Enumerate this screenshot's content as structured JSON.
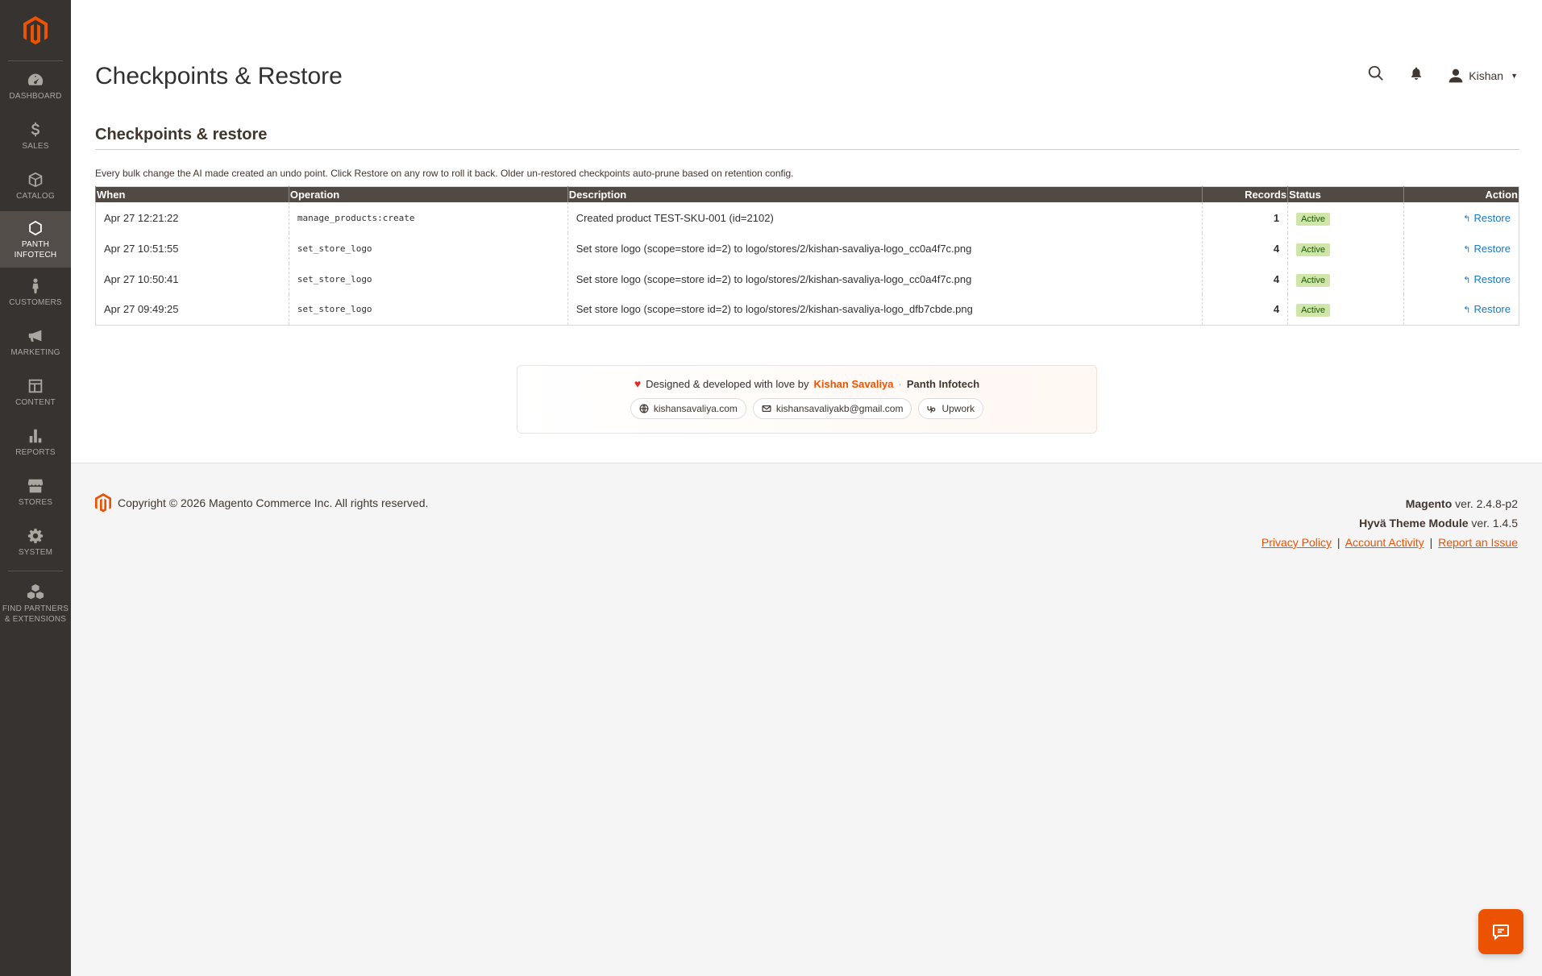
{
  "sidebar": {
    "items": [
      {
        "label": "DASHBOARD",
        "icon": "dashboard-icon"
      },
      {
        "label": "SALES",
        "icon": "dollar-icon"
      },
      {
        "label": "CATALOG",
        "icon": "box-icon"
      },
      {
        "label": "PANTH INFOTECH",
        "icon": "hexagon-icon"
      },
      {
        "label": "CUSTOMERS",
        "icon": "person-icon"
      },
      {
        "label": "MARKETING",
        "icon": "megaphone-icon"
      },
      {
        "label": "CONTENT",
        "icon": "layout-icon"
      },
      {
        "label": "REPORTS",
        "icon": "bar-chart-icon"
      },
      {
        "label": "STORES",
        "icon": "store-icon"
      },
      {
        "label": "SYSTEM",
        "icon": "gear-icon"
      },
      {
        "label": "FIND PARTNERS & EXTENSIONS",
        "icon": "cubes-icon"
      }
    ]
  },
  "header": {
    "title": "Checkpoints & Restore",
    "user_name": "Kishan"
  },
  "section": {
    "title": "Checkpoints & restore",
    "note": "Every bulk change the AI made created an undo point. Click Restore on any row to roll it back. Older un-restored checkpoints auto-prune based on retention config."
  },
  "table": {
    "columns": {
      "when": "When",
      "operation": "Operation",
      "description": "Description",
      "records": "Records",
      "status": "Status",
      "action": "Action"
    },
    "rows": [
      {
        "when": "Apr 27 12:21:22",
        "operation": "manage_products:create",
        "description": "Created product TEST-SKU-001 (id=2102)",
        "records": "1",
        "status": "Active",
        "action": "Restore"
      },
      {
        "when": "Apr 27 10:51:55",
        "operation": "set_store_logo",
        "description": "Set store logo (scope=store id=2) to logo/stores/2/kishan-savaliya-logo_cc0a4f7c.png",
        "records": "4",
        "status": "Active",
        "action": "Restore"
      },
      {
        "when": "Apr 27 10:50:41",
        "operation": "set_store_logo",
        "description": "Set store logo (scope=store id=2) to logo/stores/2/kishan-savaliya-logo_cc0a4f7c.png",
        "records": "4",
        "status": "Active",
        "action": "Restore"
      },
      {
        "when": "Apr 27 09:49:25",
        "operation": "set_store_logo",
        "description": "Set store logo (scope=store id=2) to logo/stores/2/kishan-savaliya-logo_dfb7cbde.png",
        "records": "4",
        "status": "Active",
        "action": "Restore"
      }
    ]
  },
  "credit": {
    "prefix": "Designed & developed with love by",
    "author": "Kishan Savaliya",
    "separator": "·",
    "company": "Panth Infotech",
    "chips": [
      {
        "label": "kishansavaliya.com",
        "icon": "globe-icon"
      },
      {
        "label": "kishansavaliyakb@gmail.com",
        "icon": "mail-icon"
      },
      {
        "label": "Upwork",
        "icon": "upwork-icon"
      }
    ]
  },
  "footer": {
    "copyright": "Copyright © 2026 Magento Commerce Inc. All rights reserved.",
    "magento_name": "Magento",
    "magento_version": "ver. 2.4.8-p2",
    "hyva_name": "Hyvä Theme Module",
    "hyva_version": "ver. 1.4.5",
    "links": [
      "Privacy Policy",
      "Account Activity",
      "Report an Issue"
    ],
    "link_separator": "|"
  },
  "colors": {
    "sidebar_bg": "#373330",
    "accent": "#eb5202",
    "link": "#1979c3",
    "badge_bg": "#d0e5a9",
    "table_header": "#514943"
  }
}
